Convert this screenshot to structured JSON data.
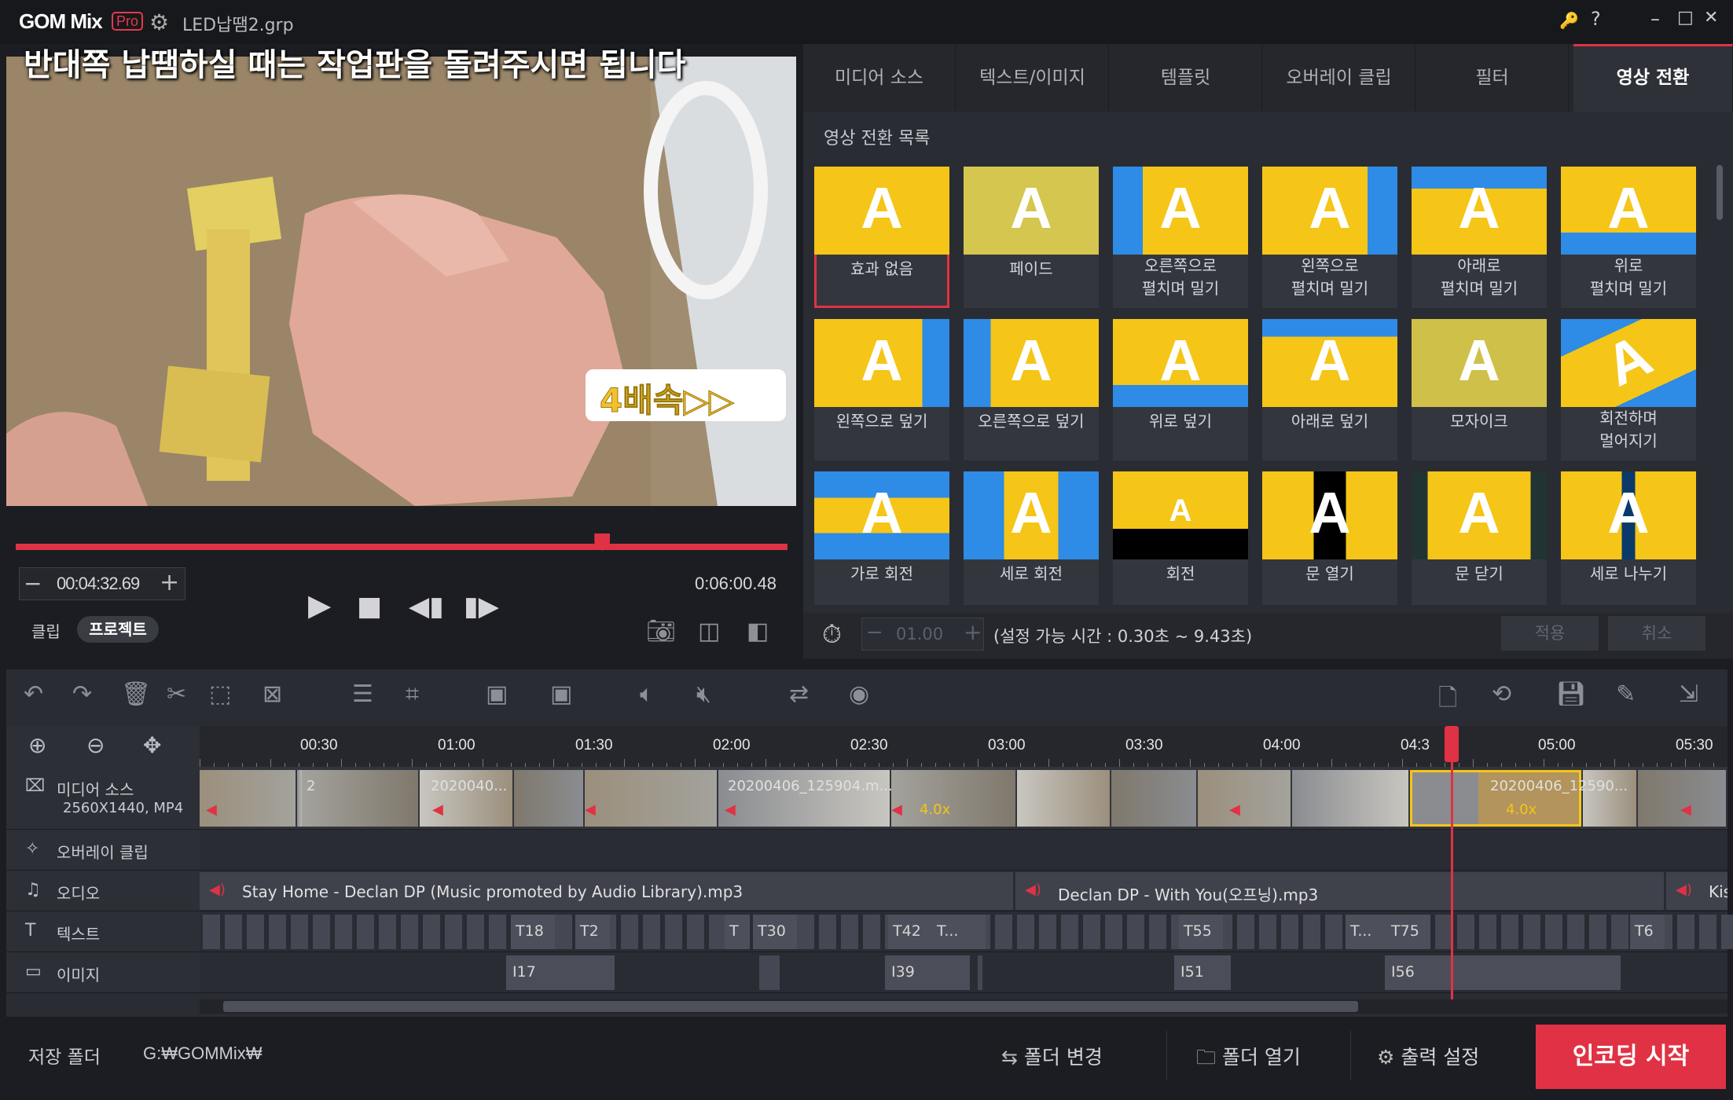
{
  "app": {
    "logo": "GOM Mix",
    "logo_badge": "Pro",
    "filename": "LED납땜2.grp"
  },
  "window_controls": {
    "key": "🔑",
    "help": "?",
    "minimize": "–",
    "maximize": "□",
    "close": "✕"
  },
  "preview": {
    "subtitle": "반대쪽 납땜하실 때는 작업판을 돌려주시면 됩니다",
    "speed_label": "4배속▷▷"
  },
  "playback": {
    "current_time": "00:04:32.69",
    "total_time": "0:06:00.48",
    "progress": 0.76,
    "tab_clip": "클립",
    "tab_project": "프로젝트"
  },
  "panel_tabs": [
    {
      "label": "미디어 소스",
      "active": false
    },
    {
      "label": "텍스트/이미지",
      "active": false
    },
    {
      "label": "템플릿",
      "active": false
    },
    {
      "label": "오버레이 클립",
      "active": false
    },
    {
      "label": "필터",
      "active": false
    },
    {
      "label": "영상 전환",
      "active": true
    }
  ],
  "transitions": {
    "list_title": "영상 전환 목록",
    "items": [
      {
        "label": "효과 없음",
        "selected": true
      },
      {
        "label": "페이드"
      },
      {
        "label": "오른쪽으로\n펼치며 밀기"
      },
      {
        "label": "왼쪽으로\n펼치며 밀기"
      },
      {
        "label": "아래로\n펼치며 밀기"
      },
      {
        "label": "위로\n펼치며 밀기"
      },
      {
        "label": "왼쪽으로 덮기"
      },
      {
        "label": "오른쪽으로 덮기"
      },
      {
        "label": "위로 덮기"
      },
      {
        "label": "아래로 덮기"
      },
      {
        "label": "모자이크"
      },
      {
        "label": "회전하며\n멀어지기"
      },
      {
        "label": "가로 회전"
      },
      {
        "label": "세로 회전"
      },
      {
        "label": "회전"
      },
      {
        "label": "문 열기"
      },
      {
        "label": "문 닫기"
      },
      {
        "label": "세로 나누기"
      }
    ],
    "duration_value": "01.00",
    "duration_range": "(설정 가능 시간 : 0.30초 ~ 9.43초)",
    "apply_label": "적용",
    "cancel_label": "취소"
  },
  "timeline": {
    "ticks": [
      "00:30",
      "01:00",
      "01:30",
      "02:00",
      "02:30",
      "03:00",
      "03:30",
      "04:00",
      "04:3",
      "05:00",
      "05:30"
    ],
    "tracks": {
      "media": {
        "label": "미디어 소스",
        "sub": "2560X1440, MP4"
      },
      "overlay": {
        "label": "오버레이 클립"
      },
      "audio": {
        "label": "오디오"
      },
      "text": {
        "label": "텍스트"
      },
      "image": {
        "label": "이미지"
      }
    },
    "media_clips": [
      {
        "text": "2"
      },
      {
        "text": "2020040..."
      },
      {
        "text": "20200406_125904.m..."
      },
      {
        "text": "4.0x"
      },
      {
        "text": "20200406_12590..."
      },
      {
        "text": "4.0x"
      }
    ],
    "audio_clips": [
      "Stay Home - Declan DP (Music promoted by Audio Library).mp3",
      "Declan DP - With You(오프닝).mp3",
      "Kis"
    ],
    "text_clips": [
      "T18",
      "T2",
      "T",
      "T30",
      "T42",
      "T...",
      "T55",
      "T...",
      "T75",
      "T6"
    ],
    "image_clips": [
      "I17",
      "I39",
      "I51",
      "I56"
    ]
  },
  "footer": {
    "save_folder_label": "저장 폴더",
    "save_path": "G:₩GOMMix₩",
    "change_folder": "폴더 변경",
    "open_folder": "폴더 열기",
    "output_settings": "출력 설정",
    "encode": "인코딩 시작"
  },
  "colors": {
    "accent": "#e03244",
    "tile_yellow": "#f5c518",
    "tile_blue": "#2e8be6"
  }
}
